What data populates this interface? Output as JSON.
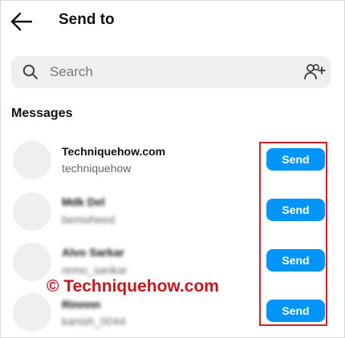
{
  "header": {
    "title": "Send to",
    "back_icon": "arrow-left-icon"
  },
  "search": {
    "placeholder": "Search",
    "icon": "search-icon",
    "add_people_icon": "add-people-icon"
  },
  "section_title": "Messages",
  "contacts": [
    {
      "name": "Techniquehow.com",
      "handle": "techniquehow",
      "send_label": "Send",
      "obscured": false
    },
    {
      "name": "Mdk Del",
      "handle": "bemoheed",
      "send_label": "Send",
      "obscured": true
    },
    {
      "name": "Alvo Sarkar",
      "handle": "remo_sankar",
      "send_label": "Send",
      "obscured": true
    },
    {
      "name": "Rinnnn",
      "handle": "kanish_0044",
      "send_label": "Send",
      "obscured": true
    }
  ],
  "watermark": "© Techniquehow.com",
  "colors": {
    "send_button": "#0095f6",
    "highlight": "#d3202a",
    "watermark": "#c8161d",
    "search_bg": "#efefef"
  }
}
